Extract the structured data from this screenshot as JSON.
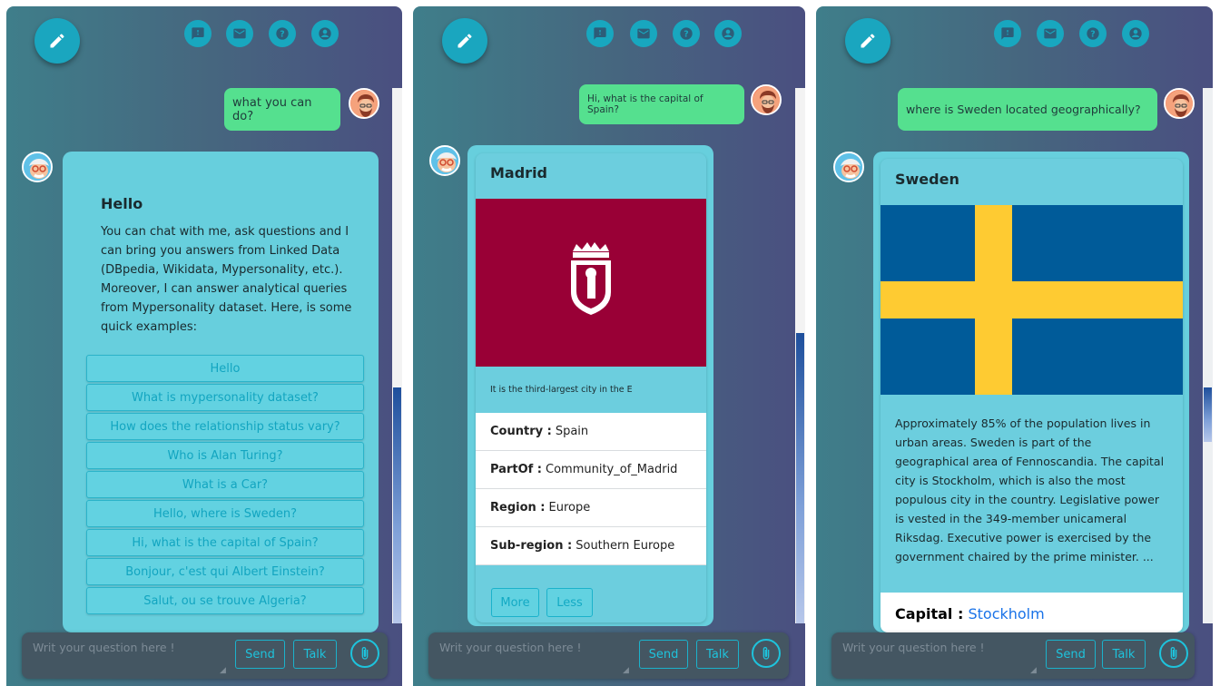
{
  "input": {
    "placeholder": "Writ your question here !",
    "send_label": "Send",
    "talk_label": "Talk"
  },
  "panel1": {
    "user_message": "what you can do?",
    "greeting_title": "Hello",
    "intro_text": "You can chat with me, ask questions and I can bring you answers from Linked Data (DBpedia, Wikidata, Mypersonality, etc.). Moreover, I can answer analytical queries from Mypersonality dataset. Here, is some quick examples:",
    "quick_examples": [
      "Hello",
      "What is mypersonality dataset?",
      "How does the relationship status vary?",
      "Who is Alan Turing?",
      "What is a Car?",
      "Hello, where is Sweden?",
      "Hi, what is the capital of Spain?",
      "Bonjour, c'est qui Albert Einstein?",
      "Salut, ou se trouve Algeria?"
    ]
  },
  "panel2": {
    "user_message": "Hi, what is the capital of Spain?",
    "card_title": "Madrid",
    "abstract": "It is the third-largest city in the E",
    "properties": [
      {
        "key": "Country :",
        "value": "Spain"
      },
      {
        "key": "PartOf :",
        "value": "Community_of_Madrid"
      },
      {
        "key": "Region :",
        "value": "Europe"
      },
      {
        "key": "Sub-region :",
        "value": "Southern Europe"
      }
    ],
    "more_label": "More",
    "less_label": "Less",
    "flag_color": "#990036"
  },
  "panel3": {
    "user_message": "where is Sweden located geographically?",
    "card_title": "Sweden",
    "abstract": "Approximately 85% of the population lives in urban areas. Sweden is part of the geographical area of Fennoscandia. The capital city is Stockholm, which is also the most populous city in the country. Legislative power is vested in the 349-member unicameral Riksdag. Executive power is exercised by the government chaired by the prime minister. ...",
    "capital_key": "Capital :",
    "capital_value": "Stockholm",
    "flag_blue": "#005b99",
    "flag_yellow": "#fecb32"
  },
  "colors": {
    "accent": "#1aa6bf",
    "user_bubble": "#55e08f",
    "bot_card": "#67cfdd"
  }
}
